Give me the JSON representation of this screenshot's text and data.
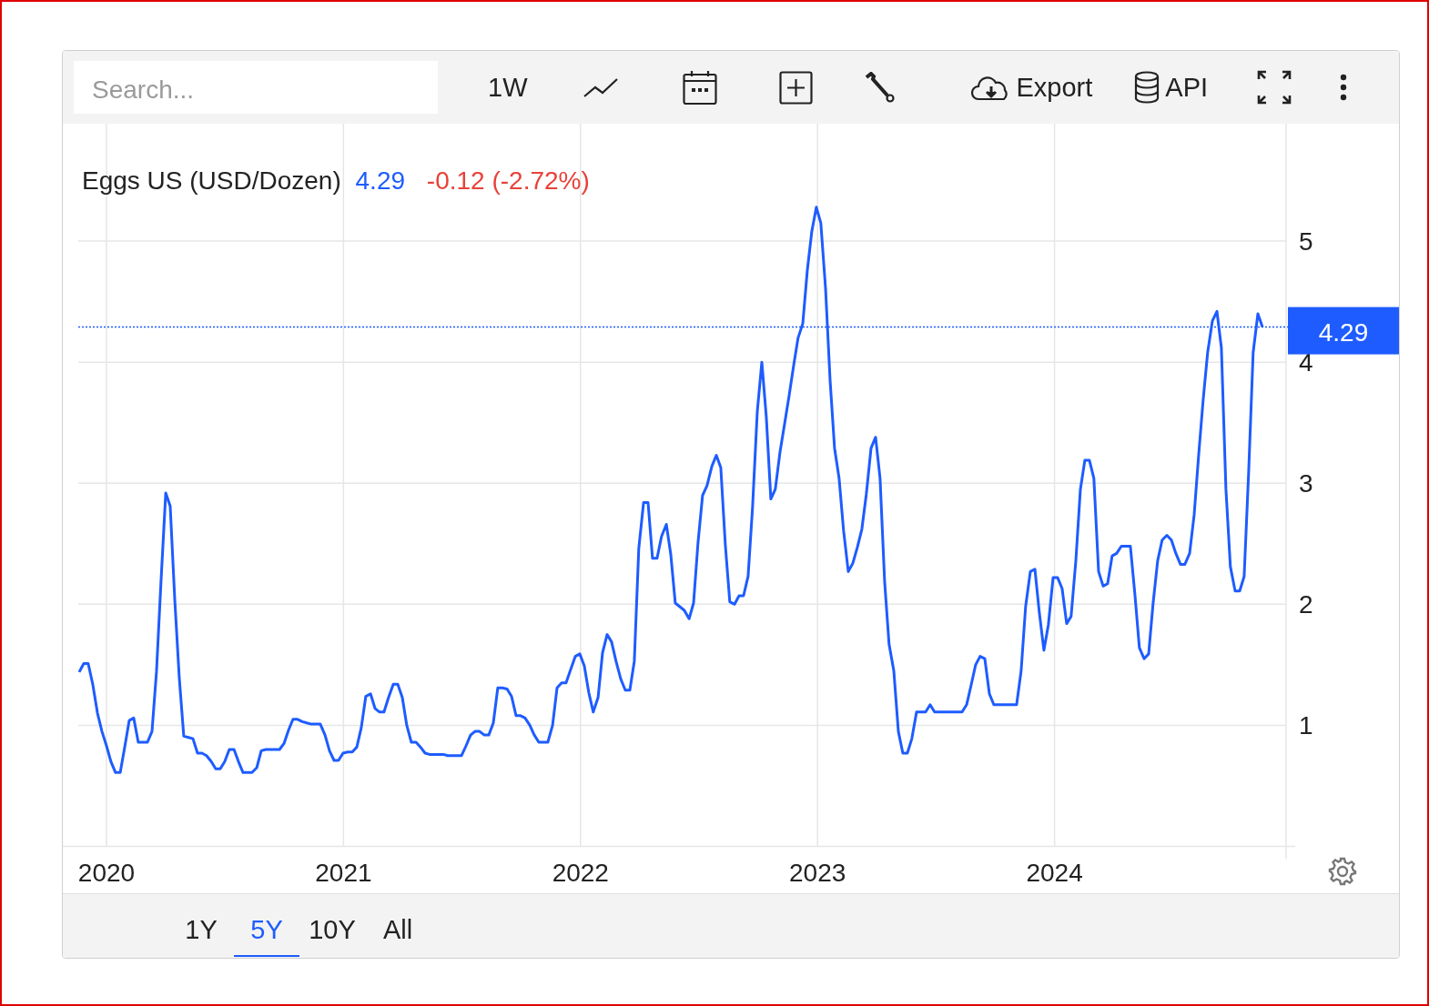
{
  "toolbar": {
    "search": {
      "placeholder": "Search..."
    },
    "interval": "1W",
    "export": "Export",
    "api": "API"
  },
  "chart": {
    "legend": {
      "last": "4.29",
      "change": "-0.12 (-2.72%)"
    },
    "price_tag": "4.29",
    "chart_data": {
      "type": "line",
      "xlim": [
        2019.881,
        2024.977
      ],
      "ylim": [
        0,
        5.97
      ],
      "xticks": [
        {
          "value": 2020,
          "label": "2020"
        },
        {
          "value": 2021,
          "label": "2021"
        },
        {
          "value": 2022,
          "label": "2022"
        },
        {
          "value": 2023,
          "label": "2023"
        },
        {
          "value": 2024,
          "label": "2024"
        }
      ],
      "yticks": [
        1,
        2,
        3,
        4,
        5
      ],
      "grid": true,
      "ref_lines": [
        {
          "axis": "y",
          "value": 4.29
        }
      ],
      "x": [
        2019.885,
        2019.904,
        2019.923,
        2019.942,
        2019.962,
        2019.981,
        2020.0,
        2020.019,
        2020.038,
        2020.058,
        2020.077,
        2020.096,
        2020.115,
        2020.134,
        2020.154,
        2020.173,
        2020.192,
        2020.211,
        2020.23,
        2020.25,
        2020.269,
        2020.288,
        2020.307,
        2020.326,
        2020.346,
        2020.365,
        2020.384,
        2020.403,
        2020.422,
        2020.442,
        2020.461,
        2020.48,
        2020.499,
        2020.518,
        2020.538,
        2020.557,
        2020.576,
        2020.595,
        2020.614,
        2020.634,
        2020.653,
        2020.672,
        2020.691,
        2020.71,
        2020.73,
        2020.749,
        2020.768,
        2020.787,
        2020.806,
        2020.826,
        2020.845,
        2020.864,
        2020.883,
        2020.902,
        2020.922,
        2020.941,
        2020.96,
        2020.979,
        2020.998,
        2021.018,
        2021.037,
        2021.056,
        2021.075,
        2021.094,
        2021.114,
        2021.133,
        2021.152,
        2021.171,
        2021.19,
        2021.21,
        2021.229,
        2021.248,
        2021.267,
        2021.286,
        2021.306,
        2021.325,
        2021.344,
        2021.363,
        2021.382,
        2021.402,
        2021.421,
        2021.44,
        2021.459,
        2021.478,
        2021.498,
        2021.517,
        2021.536,
        2021.555,
        2021.574,
        2021.594,
        2021.613,
        2021.632,
        2021.651,
        2021.67,
        2021.69,
        2021.709,
        2021.728,
        2021.747,
        2021.766,
        2021.786,
        2021.805,
        2021.824,
        2021.843,
        2021.862,
        2021.882,
        2021.901,
        2021.92,
        2021.939,
        2021.958,
        2021.978,
        2021.997,
        2022.016,
        2022.035,
        2022.054,
        2022.074,
        2022.093,
        2022.112,
        2022.131,
        2022.15,
        2022.17,
        2022.189,
        2022.208,
        2022.227,
        2022.246,
        2022.266,
        2022.285,
        2022.304,
        2022.323,
        2022.342,
        2022.362,
        2022.381,
        2022.4,
        2022.419,
        2022.438,
        2022.458,
        2022.477,
        2022.496,
        2022.515,
        2022.534,
        2022.554,
        2022.573,
        2022.592,
        2022.611,
        2022.63,
        2022.65,
        2022.669,
        2022.688,
        2022.707,
        2022.726,
        2022.746,
        2022.765,
        2022.784,
        2022.803,
        2022.822,
        2022.842,
        2022.861,
        2022.88,
        2022.899,
        2022.918,
        2022.938,
        2022.957,
        2022.976,
        2022.995,
        2023.014,
        2023.034,
        2023.053,
        2023.072,
        2023.091,
        2023.11,
        2023.13,
        2023.149,
        2023.168,
        2023.187,
        2023.206,
        2023.226,
        2023.245,
        2023.264,
        2023.283,
        2023.302,
        2023.322,
        2023.341,
        2023.36,
        2023.379,
        2023.398,
        2023.418,
        2023.437,
        2023.456,
        2023.475,
        2023.494,
        2023.514,
        2023.533,
        2023.552,
        2023.571,
        2023.59,
        2023.61,
        2023.629,
        2023.648,
        2023.667,
        2023.686,
        2023.706,
        2023.725,
        2023.744,
        2023.763,
        2023.782,
        2023.802,
        2023.821,
        2023.84,
        2023.859,
        2023.878,
        2023.898,
        2023.917,
        2023.936,
        2023.955,
        2023.974,
        2023.994,
        2024.013,
        2024.032,
        2024.051,
        2024.07,
        2024.09,
        2024.109,
        2024.128,
        2024.147,
        2024.166,
        2024.186,
        2024.205,
        2024.224,
        2024.243,
        2024.262,
        2024.282,
        2024.301,
        2024.32,
        2024.339,
        2024.358,
        2024.378,
        2024.397,
        2024.416,
        2024.435,
        2024.454,
        2024.474,
        2024.493,
        2024.512,
        2024.531,
        2024.55,
        2024.57,
        2024.589,
        2024.608,
        2024.627,
        2024.646,
        2024.666,
        2024.685,
        2024.704,
        2024.723,
        2024.742,
        2024.762,
        2024.781,
        2024.8,
        2024.819,
        2024.838,
        2024.858,
        2024.877
      ],
      "series": [
        {
          "name": "Eggs US (USD/Dozen)",
          "color": "#1e5cff",
          "values": [
            1.44,
            1.51,
            1.51,
            1.34,
            1.1,
            0.95,
            0.83,
            0.7,
            0.61,
            0.61,
            0.82,
            1.04,
            1.06,
            0.86,
            0.86,
            0.86,
            0.95,
            1.44,
            2.19,
            2.92,
            2.81,
            2.04,
            1.4,
            0.91,
            0.9,
            0.89,
            0.77,
            0.77,
            0.75,
            0.7,
            0.64,
            0.64,
            0.7,
            0.8,
            0.8,
            0.7,
            0.61,
            0.61,
            0.61,
            0.65,
            0.79,
            0.8,
            0.8,
            0.8,
            0.8,
            0.85,
            0.96,
            1.05,
            1.05,
            1.03,
            1.02,
            1.01,
            1.01,
            1.01,
            0.92,
            0.79,
            0.71,
            0.71,
            0.77,
            0.78,
            0.78,
            0.82,
            0.98,
            1.24,
            1.26,
            1.14,
            1.11,
            1.11,
            1.23,
            1.34,
            1.34,
            1.23,
            1.0,
            0.86,
            0.86,
            0.82,
            0.77,
            0.76,
            0.76,
            0.76,
            0.76,
            0.75,
            0.75,
            0.75,
            0.75,
            0.83,
            0.92,
            0.95,
            0.95,
            0.92,
            0.92,
            1.02,
            1.31,
            1.31,
            1.3,
            1.24,
            1.08,
            1.08,
            1.06,
            1.0,
            0.92,
            0.86,
            0.86,
            0.86,
            1.0,
            1.31,
            1.35,
            1.35,
            1.46,
            1.57,
            1.59,
            1.49,
            1.27,
            1.11,
            1.23,
            1.6,
            1.75,
            1.69,
            1.53,
            1.38,
            1.29,
            1.29,
            1.53,
            2.46,
            2.84,
            2.84,
            2.38,
            2.38,
            2.56,
            2.66,
            2.41,
            2.01,
            1.98,
            1.95,
            1.88,
            2.01,
            2.51,
            2.9,
            2.98,
            3.14,
            3.23,
            3.13,
            2.49,
            2.02,
            2.0,
            2.07,
            2.07,
            2.23,
            2.8,
            3.59,
            4.0,
            3.55,
            2.87,
            2.95,
            3.26,
            3.49,
            3.72,
            3.97,
            4.2,
            4.32,
            4.76,
            5.08,
            5.28,
            5.15,
            4.61,
            3.85,
            3.29,
            3.04,
            2.61,
            2.27,
            2.34,
            2.47,
            2.62,
            2.91,
            3.29,
            3.38,
            3.04,
            2.19,
            1.67,
            1.45,
            0.95,
            0.77,
            0.77,
            0.89,
            1.11,
            1.11,
            1.11,
            1.17,
            1.11,
            1.11,
            1.11,
            1.11,
            1.11,
            1.11,
            1.11,
            1.17,
            1.33,
            1.5,
            1.57,
            1.55,
            1.26,
            1.17,
            1.17,
            1.17,
            1.17,
            1.17,
            1.17,
            1.45,
            1.98,
            2.27,
            2.29,
            1.93,
            1.62,
            1.83,
            2.22,
            2.22,
            2.13,
            1.84,
            1.9,
            2.36,
            2.95,
            3.19,
            3.19,
            3.04,
            2.27,
            2.15,
            2.17,
            2.4,
            2.42,
            2.48,
            2.48,
            2.48,
            2.08,
            1.64,
            1.55,
            1.59,
            2.01,
            2.36,
            2.53,
            2.57,
            2.53,
            2.42,
            2.33,
            2.33,
            2.42,
            2.74,
            3.23,
            3.69,
            4.08,
            4.34,
            4.42,
            4.12,
            2.95,
            2.31,
            2.11,
            2.11,
            2.23,
            3.1,
            4.08,
            4.4,
            4.29
          ]
        }
      ]
    }
  },
  "ranges": [
    {
      "label": "1Y",
      "selected": false
    },
    {
      "label": "5Y",
      "selected": true
    },
    {
      "label": "10Y",
      "selected": false
    },
    {
      "label": "All",
      "selected": false
    }
  ]
}
